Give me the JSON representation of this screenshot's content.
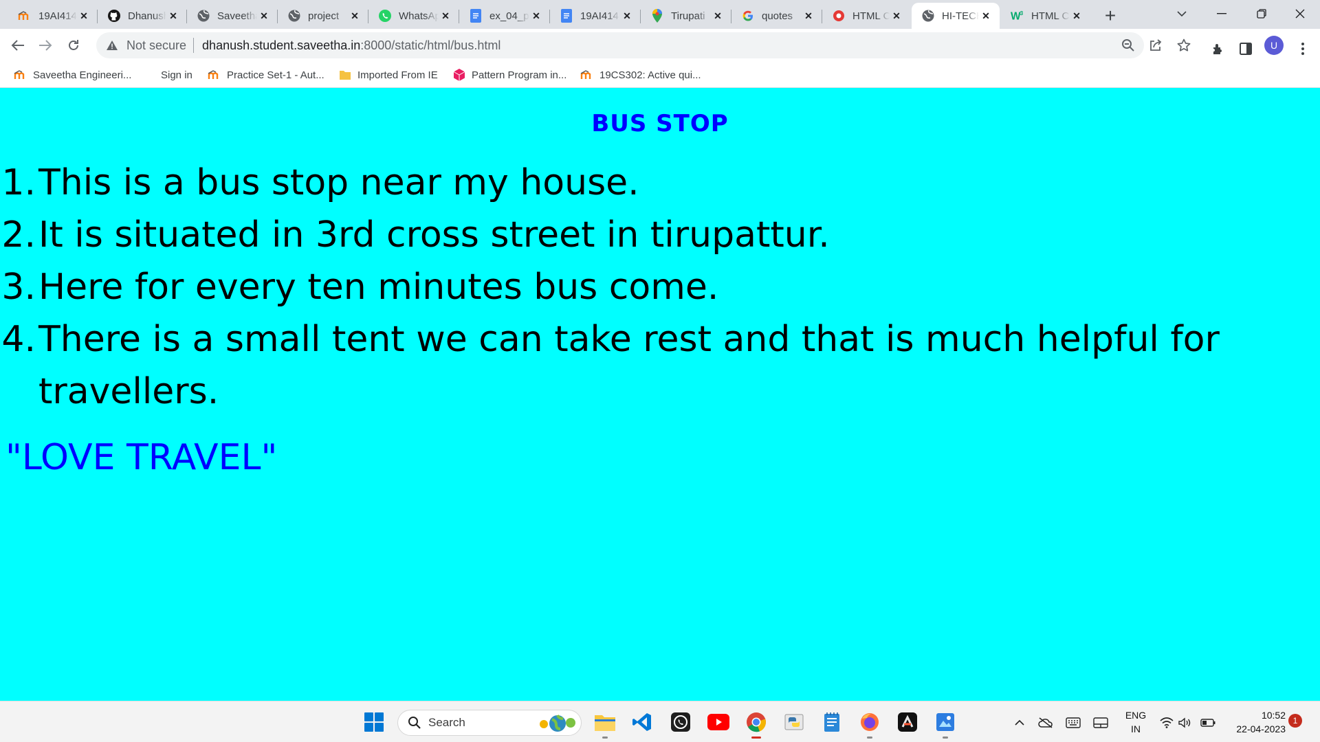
{
  "browser": {
    "tabs": [
      {
        "title": "19AI414",
        "icon": "moodle-icon"
      },
      {
        "title": "Dhanush",
        "icon": "github-icon"
      },
      {
        "title": "Saveetha",
        "icon": "globe-icon"
      },
      {
        "title": "project",
        "icon": "globe-icon"
      },
      {
        "title": "WhatsApp",
        "icon": "whatsapp-icon"
      },
      {
        "title": "ex_04_p",
        "icon": "docs-icon"
      },
      {
        "title": "19AI414",
        "icon": "docs-icon"
      },
      {
        "title": "Tirupati",
        "icon": "maps-icon"
      },
      {
        "title": "quotes",
        "icon": "google-icon"
      },
      {
        "title": "HTML C",
        "icon": "record-icon"
      },
      {
        "title": "HI-TECH",
        "icon": "globe-icon",
        "active": true
      },
      {
        "title": "HTML C",
        "icon": "w3schools-icon"
      }
    ],
    "address": {
      "security": "Not secure",
      "host": "dhanush.student.saveetha.in",
      "path": ":8000/static/html/bus.html"
    },
    "profile_initial": "U",
    "bookmarks": [
      {
        "label": "Saveetha Engineeri...",
        "icon": "moodle-icon"
      },
      {
        "label": "Sign in",
        "icon": "none"
      },
      {
        "label": "Practice Set-1 - Aut...",
        "icon": "moodle-icon"
      },
      {
        "label": "Imported From IE",
        "icon": "folder-icon"
      },
      {
        "label": "Pattern Program in...",
        "icon": "cube-icon"
      },
      {
        "label": "19CS302: Active qui...",
        "icon": "moodle-icon"
      }
    ]
  },
  "page": {
    "heading": "BUS STOP",
    "items": [
      {
        "num": "1.",
        "text": "This is a bus stop near my house."
      },
      {
        "num": "2.",
        "text": "It is situated in 3rd cross street in tirupattur."
      },
      {
        "num": "3.",
        "text": "Here for every ten minutes bus come."
      },
      {
        "num": "4.",
        "text": "There is a small tent we can take rest and that is much helpful for travellers."
      }
    ],
    "quote": "\"LOVE TRAVEL\"",
    "colors": {
      "background": "#00ffff",
      "heading": "#0000ff",
      "quote": "#0000ff",
      "text": "#000000"
    }
  },
  "taskbar": {
    "search_placeholder": "Search",
    "language": {
      "line1": "ENG",
      "line2": "IN"
    },
    "time": "10:52",
    "date": "22-04-2023",
    "notification_count": "1"
  }
}
